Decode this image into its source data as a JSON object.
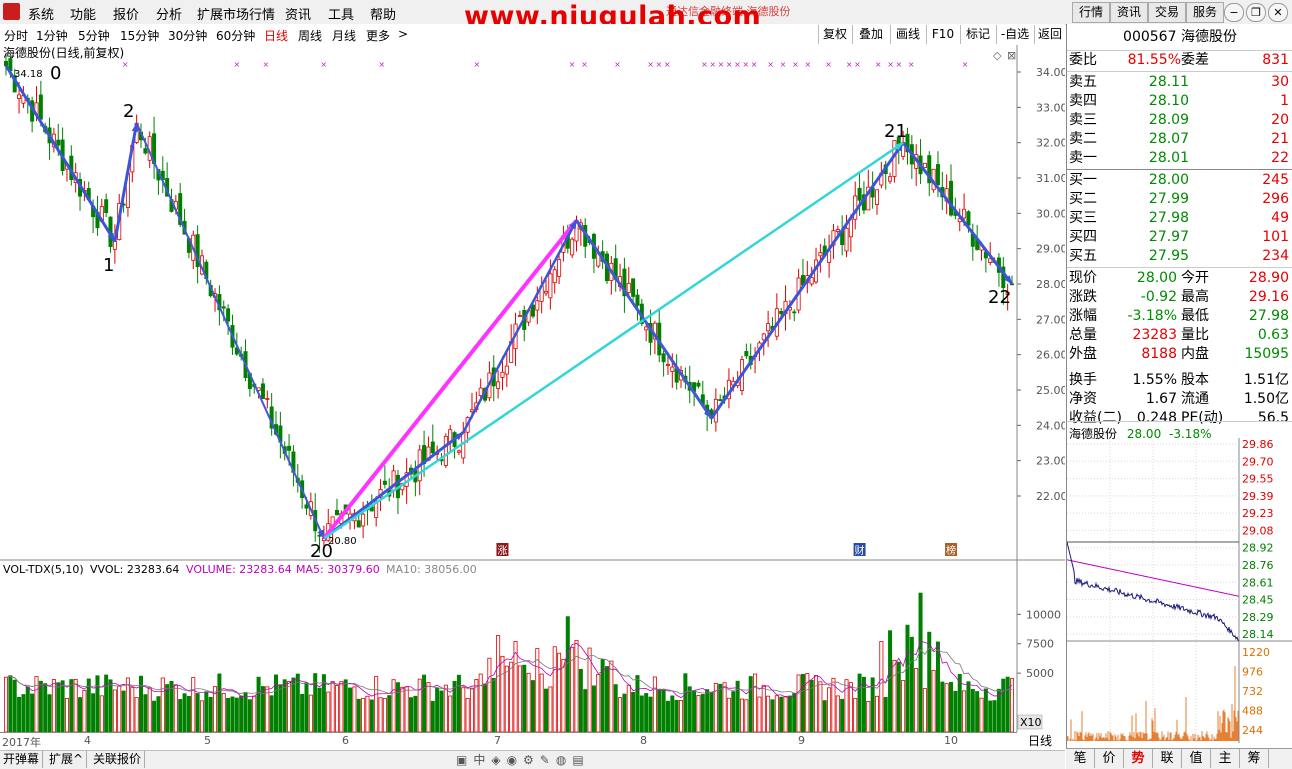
{
  "menu": {
    "items": [
      "系统",
      "功能",
      "报价",
      "分析",
      "扩展市场行情",
      "资讯",
      "工具",
      "帮助"
    ],
    "watermark": "www.niugulah.com",
    "watermark_sub": "通达信金融终端  海德股份",
    "right_buttons": [
      "行情",
      "资讯",
      "交易",
      "服务"
    ]
  },
  "periods": {
    "items": [
      "分时",
      "1分钟",
      "5分钟",
      "15分钟",
      "30分钟",
      "60分钟",
      "日线",
      "周线",
      "月线",
      "更多"
    ],
    "active": "日线",
    "more_arrow": ">",
    "tools": [
      "复权",
      "叠加",
      "画线",
      "F10",
      "标记",
      "-自选",
      "返回"
    ]
  },
  "main_chart": {
    "title": "海德股份(日线,前复权)",
    "y_ticks": [
      "34.00",
      "33.00",
      "32.00",
      "31.00",
      "30.00",
      "29.00",
      "28.00",
      "27.00",
      "26.00",
      "25.00",
      "24.00",
      "23.00",
      "22.00"
    ],
    "high_label": "34.18",
    "low_label": "20.80",
    "wave_labels": [
      "0",
      "1",
      "2",
      "20",
      "21",
      "22"
    ],
    "event_markers": [
      "涨",
      "财",
      "榜"
    ]
  },
  "volume_chart": {
    "legend": {
      "indicator": "VOL-TDX(5,10)",
      "vvol": "VVOL: 23283.64",
      "volume": "VOLUME: 23283.64",
      "ma5": "MA5: 30379.60",
      "ma10": "MA10: 38056.00"
    },
    "y_ticks": [
      "10000",
      "7500",
      "5000"
    ],
    "unit": "X10"
  },
  "x_axis": {
    "labels": [
      "2017年",
      "4",
      "5",
      "6",
      "7",
      "8",
      "9",
      "10"
    ],
    "period": "日线"
  },
  "bottom_tabs": [
    "开弹幕",
    "扩展^",
    "关联报价"
  ],
  "quote": {
    "code": "000567",
    "name": "海德股份",
    "webi_label": "委比",
    "webi": "81.55%",
    "weicha_label": "委差",
    "weicha": "831",
    "asks": [
      {
        "label": "卖五",
        "price": "28.11",
        "vol": "30"
      },
      {
        "label": "卖四",
        "price": "28.10",
        "vol": "1"
      },
      {
        "label": "卖三",
        "price": "28.09",
        "vol": "20"
      },
      {
        "label": "卖二",
        "price": "28.07",
        "vol": "21"
      },
      {
        "label": "卖一",
        "price": "28.01",
        "vol": "22"
      }
    ],
    "bids": [
      {
        "label": "买一",
        "price": "28.00",
        "vol": "245"
      },
      {
        "label": "买二",
        "price": "27.99",
        "vol": "296"
      },
      {
        "label": "买三",
        "price": "27.98",
        "vol": "49"
      },
      {
        "label": "买四",
        "price": "27.97",
        "vol": "101"
      },
      {
        "label": "买五",
        "price": "27.95",
        "vol": "234"
      }
    ],
    "stats": [
      {
        "l1": "现价",
        "v1": "28.00",
        "l2": "今开",
        "v2": "28.90",
        "c1": "green",
        "c2": "red"
      },
      {
        "l1": "涨跌",
        "v1": "-0.92",
        "l2": "最高",
        "v2": "29.16",
        "c1": "green",
        "c2": "red"
      },
      {
        "l1": "涨幅",
        "v1": "-3.18%",
        "l2": "最低",
        "v2": "27.98",
        "c1": "green",
        "c2": "green"
      },
      {
        "l1": "总量",
        "v1": "23283",
        "l2": "量比",
        "v2": "0.63",
        "c1": "red",
        "c2": "green"
      },
      {
        "l1": "外盘",
        "v1": "8188",
        "l2": "内盘",
        "v2": "15095",
        "c1": "red",
        "c2": "green"
      },
      {
        "l1": "换手",
        "v1": "1.55%",
        "l2": "股本",
        "v2": "1.51亿",
        "c1": "blk",
        "c2": "blk"
      },
      {
        "l1": "净资",
        "v1": "1.67",
        "l2": "流通",
        "v2": "1.50亿",
        "c1": "blk",
        "c2": "blk"
      },
      {
        "l1": "收益(二)",
        "v1": "0.248",
        "l2": "PE(动)",
        "v2": "56.5",
        "c1": "blk",
        "c2": "blk"
      }
    ]
  },
  "mini_chart": {
    "title": "海德股份",
    "price": "28.00",
    "change": "-3.18%",
    "y_ticks": [
      "29.86",
      "29.70",
      "29.55",
      "29.39",
      "29.23",
      "29.08",
      "28.92",
      "28.76",
      "28.61",
      "28.45",
      "28.29",
      "28.14"
    ],
    "vol_ticks": [
      "1220",
      "976",
      "732",
      "488",
      "244"
    ]
  },
  "right_tabs": [
    "笔",
    "价",
    "势",
    "联",
    "值",
    "主",
    "筹"
  ],
  "right_tabs_active": "势"
}
